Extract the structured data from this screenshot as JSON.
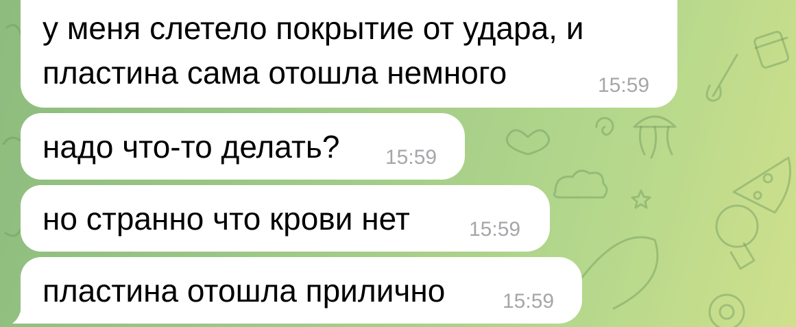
{
  "chat": {
    "messages": [
      {
        "lines": [
          "у меня слетело покрытие от удара, и",
          "пластина сама отошла немного"
        ],
        "time": "15:59"
      },
      {
        "text": "надо что-то делать?",
        "time": "15:59"
      },
      {
        "text": "но странно что крови нет",
        "time": "15:59"
      },
      {
        "text": "пластина отошла прилично",
        "time": "15:59"
      }
    ]
  },
  "colors": {
    "bubble_incoming": "#ffffff",
    "timestamp": "#a4a6a9",
    "wallpaper_start": "#8dbc7e",
    "wallpaper_end": "#cfe08c"
  },
  "icons": [
    "gift-icon",
    "paintbrush-icon",
    "jellyfish-icon",
    "heart-icon",
    "pizza-icon",
    "lightbulb-icon",
    "star-icon",
    "cloud-icon",
    "billiard-ball-icon",
    "leaf-icon"
  ]
}
